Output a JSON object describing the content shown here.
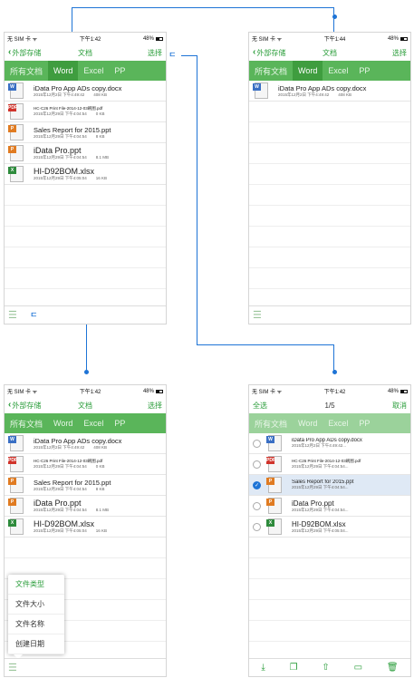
{
  "status": {
    "carrier": "无 SIM 卡 ᯤ",
    "time_a": "下午1:42",
    "time_b": "下午1:44",
    "battery": "48%"
  },
  "nav": {
    "back_label": "外部存储",
    "title": "文档",
    "select": "选择",
    "select_all": "全选",
    "count": "1/5",
    "cancel": "取消"
  },
  "tabs": [
    "所有文档",
    "Word",
    "Excel",
    "PP"
  ],
  "files": [
    {
      "name": "iData Pro App ADs copy.docx",
      "date": "2015年12月2日 下午4:49:42",
      "size": "408 KB",
      "type": "W",
      "color": "#3a6fc4",
      "small": false
    },
    {
      "name": "HC-C26 Print File-2014-12-03刷图.pdf",
      "date": "2015年12月29日 下午4:04:54",
      "size": "0 KB",
      "type": "PDF",
      "color": "#d0332b",
      "small": true
    },
    {
      "name": "Sales Report for 2015.ppt",
      "date": "2015年12月29日 下午4:04:54",
      "size": "8 KB",
      "type": "P",
      "color": "#e07b21",
      "small": false
    },
    {
      "name": "iData Pro.ppt",
      "date": "2015年12月29日 下午4:04:54",
      "size": "8.1 MB",
      "type": "P",
      "color": "#e07b21",
      "small": false
    },
    {
      "name": "HI-D92BOM.xlsx",
      "date": "2015年12月29日 下午4:05:04",
      "size": "16 KB",
      "type": "X",
      "color": "#2e8b3c",
      "small": false
    }
  ],
  "select_files": [
    {
      "name": "iData Pro App ADs copy.docx",
      "date": "2015年12月2日 下午4:49:42...",
      "checked": false
    },
    {
      "name": "HC-C26 Print File-2014-12-03刷图.pdf",
      "date": "2015年12月29日 下午4:04:54...",
      "checked": false
    },
    {
      "name": "Sales Report for 2015.ppt",
      "date": "2015年12月29日 下午4:04:54...",
      "checked": true
    },
    {
      "name": "iData Pro.ppt",
      "date": "2015年12月29日 下午4:04:54...",
      "checked": false
    },
    {
      "name": "HI-D92BOM.xlsx",
      "date": "2015年12月29日 下午4:05:04...",
      "checked": false
    }
  ],
  "sort_menu": [
    "文件类型",
    "文件大小",
    "文件名称",
    "创建日期"
  ],
  "icons": {
    "sort": "list-sort-icon",
    "back": "chevron-left-icon",
    "actions": [
      "import-icon",
      "copy-icon",
      "share-icon",
      "folder-icon",
      "trash-icon"
    ]
  },
  "accent": "#2a9d3a",
  "tab_bar": "#5ab55a",
  "connector": "#1e74d6"
}
